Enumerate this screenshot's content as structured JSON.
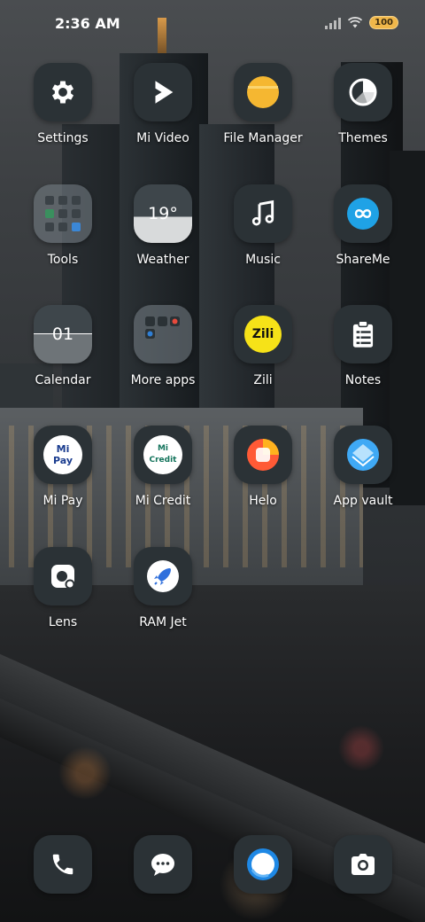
{
  "status_bar": {
    "time": "2:36 AM",
    "battery": "100",
    "icons": [
      "signal-icon",
      "wifi-icon",
      "battery-icon"
    ]
  },
  "apps": [
    {
      "label": "Settings",
      "icon": "gear-icon"
    },
    {
      "label": "Mi Video",
      "icon": "play-icon"
    },
    {
      "label": "File Manager",
      "icon": "folder-icon"
    },
    {
      "label": "Themes",
      "icon": "themes-icon"
    },
    {
      "label": "Tools",
      "icon": "tools-folder-icon"
    },
    {
      "label": "Weather",
      "icon": "weather-icon",
      "value": "19°"
    },
    {
      "label": "Music",
      "icon": "music-note-icon"
    },
    {
      "label": "ShareMe",
      "icon": "infinity-icon"
    },
    {
      "label": "Calendar",
      "icon": "calendar-icon",
      "value": "01"
    },
    {
      "label": "More apps",
      "icon": "apps-folder-icon"
    },
    {
      "label": "Zili",
      "icon": "zili-icon",
      "value": "Zili"
    },
    {
      "label": "Notes",
      "icon": "clipboard-icon"
    },
    {
      "label": "Mi Pay",
      "icon": "mi-pay-icon",
      "value": "Mi Pay"
    },
    {
      "label": "Mi Credit",
      "icon": "mi-credit-icon",
      "value": "Mi Credit"
    },
    {
      "label": "Helo",
      "icon": "helo-icon"
    },
    {
      "label": "App vault",
      "icon": "app-vault-icon"
    },
    {
      "label": "Lens",
      "icon": "lens-icon"
    },
    {
      "label": "RAM Jet",
      "icon": "rocket-icon"
    }
  ],
  "dock": [
    {
      "icon": "phone-icon"
    },
    {
      "icon": "message-icon"
    },
    {
      "icon": "browser-icon"
    },
    {
      "icon": "camera-icon"
    }
  ],
  "colors": {
    "icon_bg": "#2b3236",
    "file_manager": "#f5b731",
    "shareme": "#1fa2e6",
    "zili": "#f6e218",
    "helo": "#ff5a36",
    "app_vault": "#3fa9f5",
    "battery": "#f0b74a"
  }
}
